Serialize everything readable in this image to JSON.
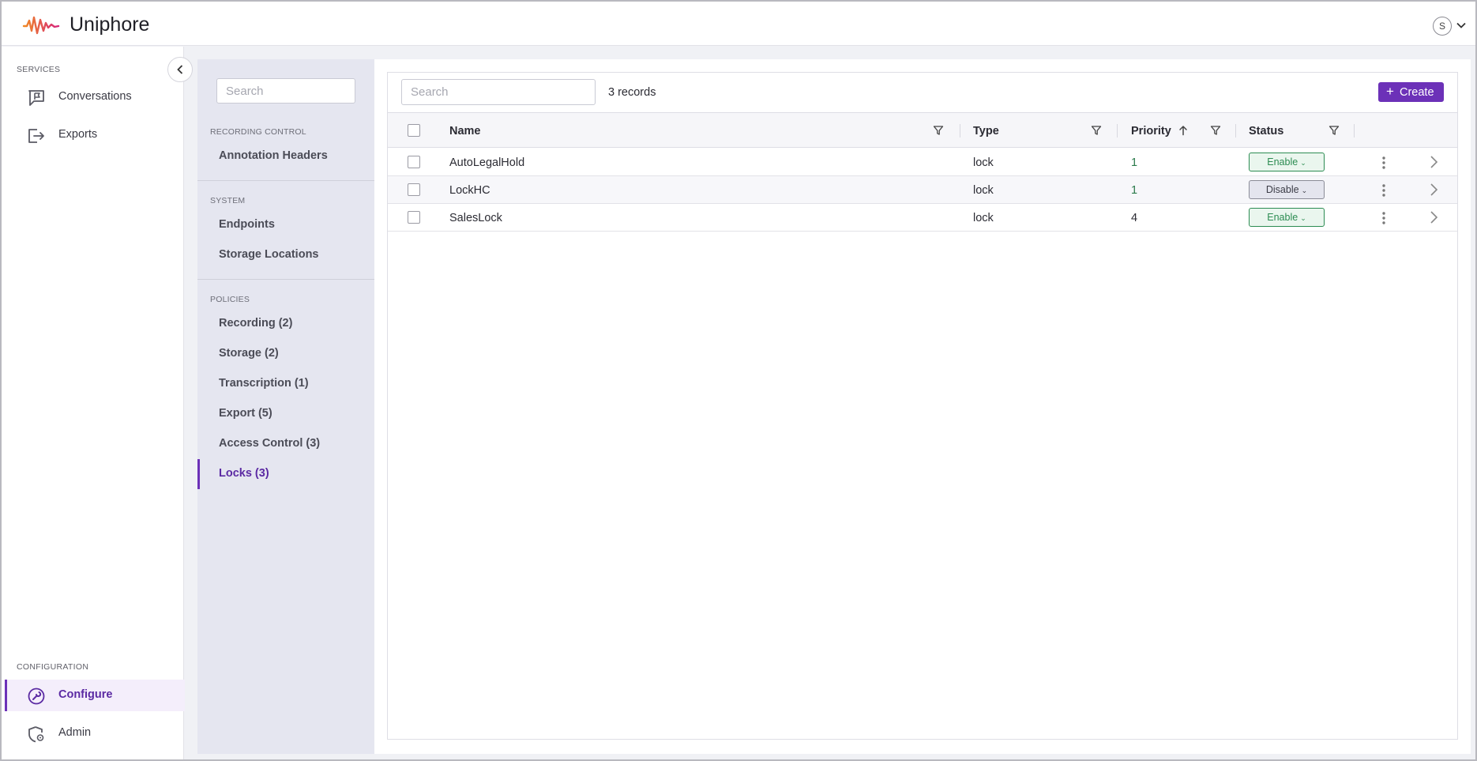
{
  "app": {
    "brand": "Uniphore",
    "avatar_initial": "S"
  },
  "leftnav": {
    "services_label": "SERVICES",
    "services": [
      {
        "label": "Conversations",
        "icon": "chat-flag-icon"
      },
      {
        "label": "Exports",
        "icon": "export-icon"
      }
    ],
    "configuration_label": "CONFIGURATION",
    "configuration": [
      {
        "label": "Configure",
        "icon": "wrench-icon",
        "active": true
      },
      {
        "label": "Admin",
        "icon": "shield-gear-icon"
      }
    ]
  },
  "subnav": {
    "search_placeholder": "Search",
    "sections": [
      {
        "label": "RECORDING CONTROL",
        "items": [
          "Annotation Headers"
        ]
      },
      {
        "label": "SYSTEM",
        "items": [
          "Endpoints",
          "Storage Locations"
        ]
      },
      {
        "label": "POLICIES",
        "items": [
          "Recording (2)",
          "Storage (2)",
          "Transcription (1)",
          "Export (5)",
          "Access Control (3)",
          "Locks (3)"
        ]
      }
    ],
    "active_item": "Locks (3)"
  },
  "main": {
    "search_placeholder": "Search",
    "records_count": "3 records",
    "create_label": "Create",
    "columns": {
      "name": "Name",
      "type": "Type",
      "priority": "Priority",
      "status": "Status"
    },
    "rows": [
      {
        "name": "AutoLegalHold",
        "type": "lock",
        "priority": "1",
        "status": "Enable"
      },
      {
        "name": "LockHC",
        "type": "lock",
        "priority": "1",
        "status": "Disable"
      },
      {
        "name": "SalesLock",
        "type": "lock",
        "priority": "4",
        "status": "Enable"
      }
    ]
  },
  "colors": {
    "accent": "#6c31b8",
    "enable": "#2c8c52",
    "disable": "#8b8c97"
  }
}
